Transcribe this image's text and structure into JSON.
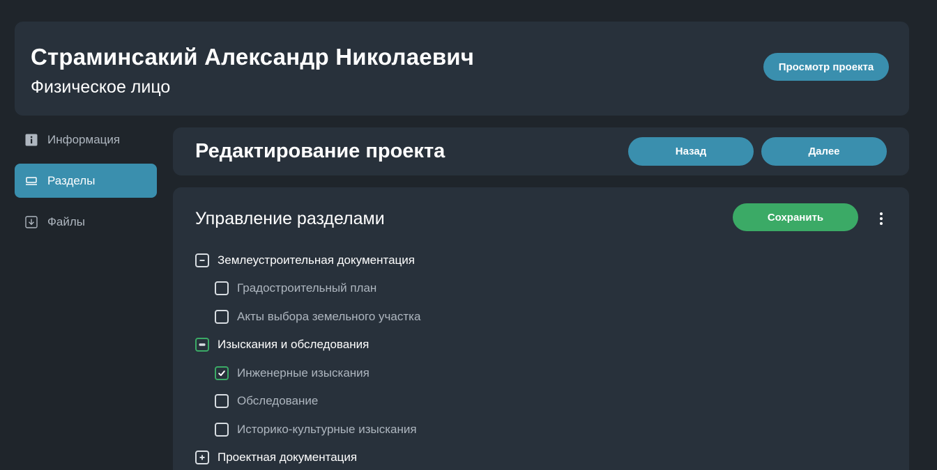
{
  "header": {
    "client_name": "Страминсакий Александр Николаевич",
    "client_type": "Физическое лицо",
    "view_project_label": "Просмотр проекта"
  },
  "sidebar": {
    "items": [
      {
        "label": "Информация",
        "icon": "info-icon",
        "active": false
      },
      {
        "label": "Разделы",
        "icon": "sections-icon",
        "active": true
      },
      {
        "label": "Файлы",
        "icon": "download-file-icon",
        "active": false
      }
    ]
  },
  "title_bar": {
    "title": "Редактирование проекта",
    "back_label": "Назад",
    "next_label": "Далее"
  },
  "sections": {
    "title": "Управление разделами",
    "save_label": "Сохранить",
    "more_icon": "more-vertical-icon",
    "groups": [
      {
        "label": "Землеустроительная документация",
        "state": "expanded",
        "items": [
          {
            "label": "Градостроительный план",
            "checked": false
          },
          {
            "label": "Акты выбора земельного участка",
            "checked": false
          }
        ]
      },
      {
        "label": "Изыскания и обследования",
        "state": "expanded-partial",
        "items": [
          {
            "label": "Инженерные изыскания",
            "checked": true
          },
          {
            "label": "Обследование",
            "checked": false
          },
          {
            "label": "Историко-культурные изыскания",
            "checked": false
          }
        ]
      },
      {
        "label": "Проектная документация",
        "state": "collapsed",
        "items": []
      }
    ]
  },
  "colors": {
    "background": "#1f252b",
    "card": "#28313b",
    "accent_blue": "#3a8fae",
    "accent_green": "#3baa66",
    "muted_text": "#aeb6bf"
  }
}
